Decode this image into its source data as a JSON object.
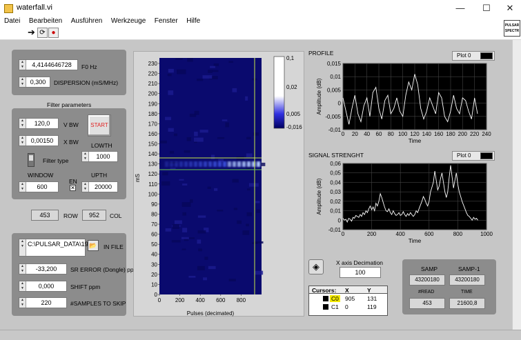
{
  "window": {
    "title": "waterfall.vi",
    "minimize": "—",
    "maximize": "☐",
    "close": "✕"
  },
  "menu": [
    "Datei",
    "Bearbeiten",
    "Ausführen",
    "Werkzeuge",
    "Fenster",
    "Hilfe"
  ],
  "vi_icon_text": [
    "PULSAR",
    "SPECTR"
  ],
  "controls": {
    "f0": {
      "value": "4,4144646728",
      "label": "F0 Hz"
    },
    "dispersion": {
      "value": "0,300",
      "label": "DISPERSION (mS/MHz)"
    },
    "filter_title": "Filter parameters",
    "vbw": {
      "value": "120,0",
      "label": "V BW"
    },
    "xbw": {
      "value": "0,00150",
      "label": "X BW"
    },
    "start_label": "START",
    "lowth": {
      "label": "LOWTH",
      "value": "1000"
    },
    "filter_type_label": "Filter type",
    "window": {
      "label": "WINDOW",
      "value": "600"
    },
    "en_label": "EN",
    "upth": {
      "label": "UPTH",
      "value": "20000"
    },
    "row": {
      "value": "453",
      "label": "ROW"
    },
    "col": {
      "value": "952",
      "label": "COL"
    },
    "in_file": {
      "value": "C:\\PULSAR_DATA\\1929+",
      "label": "IN FILE"
    },
    "sr_error": {
      "value": "-33,200",
      "label": "SR ERROR (Dongle) ppm"
    },
    "shift": {
      "value": "0,000",
      "label": "SHIFT ppm"
    },
    "samples_skip": {
      "value": "220",
      "label": "#SAMPLES TO SKIP"
    }
  },
  "waterfall": {
    "ylabel": "mS",
    "xlabel": "Pulses (decimated)",
    "y_ticks": [
      "230",
      "220",
      "210",
      "200",
      "190",
      "180",
      "170",
      "160",
      "150",
      "140",
      "130",
      "120",
      "110",
      "100",
      "90",
      "80",
      "70",
      "60",
      "50",
      "40",
      "30",
      "20",
      "10",
      "0"
    ],
    "x_ticks": [
      "0",
      "200",
      "400",
      "600",
      "800"
    ],
    "colorbar_ticks": [
      "0,1",
      "0,02",
      "0,005",
      "-0,016"
    ],
    "cursor_colors": [
      "#c8e84a",
      "#6ac850"
    ]
  },
  "decimation": {
    "label": "X axis Decimation",
    "value": "100"
  },
  "cursors": {
    "headers": [
      "Cursors:",
      "X",
      "Y"
    ],
    "rows": [
      {
        "name": "C0",
        "x": "905",
        "y": "131"
      },
      {
        "name": "C1",
        "x": "0",
        "y": "119"
      }
    ]
  },
  "samp_box": {
    "samp_label": "SAMP",
    "samp_value": "43200180",
    "samp1_label": "SAMP-1",
    "samp1_value": "43200180",
    "read_label": "#READ",
    "read_value": "453",
    "time_label": "TIME",
    "time_value": "21600,8"
  },
  "chart_data": [
    {
      "type": "line",
      "title": "PROFILE",
      "legend": "Plot 0",
      "xlabel": "Time",
      "ylabel": "Amplitude (dB)",
      "xlim": [
        0,
        240
      ],
      "ylim": [
        -0.01,
        0.015
      ],
      "x_ticks": [
        "0",
        "20",
        "40",
        "60",
        "80",
        "100",
        "120",
        "140",
        "160",
        "180",
        "200",
        "220",
        "240"
      ],
      "y_ticks": [
        "0,015",
        "0,01",
        "0,005",
        "0",
        "-0,005",
        "-0,01"
      ],
      "grid": true,
      "series": [
        {
          "name": "Plot 0",
          "x_step": 5,
          "values": [
            0.002,
            -0.003,
            -0.008,
            -0.002,
            0.003,
            -0.004,
            -0.007,
            -0.001,
            0.002,
            -0.005,
            0.004,
            0.006,
            -0.002,
            -0.006,
            0.001,
            0.003,
            -0.004,
            -0.002,
            0.002,
            -0.003,
            -0.005,
            0.003,
            0.008,
            0.005,
            0.011,
            0.007,
            -0.002,
            -0.006,
            -0.003,
            0.002,
            -0.001,
            -0.004,
            0.004,
            0.002,
            -0.005,
            -0.007,
            -0.003,
            0.003,
            -0.002,
            -0.004,
            0.002,
            0.001,
            -0.003,
            -0.006,
            0.002,
            -0.004
          ]
        }
      ]
    },
    {
      "type": "line",
      "title": "SIGNAL STRENGHT",
      "legend": "Plot 0",
      "xlabel": "Time",
      "ylabel": "Amplitude (dB)",
      "xlim": [
        0,
        1000
      ],
      "ylim": [
        -0.01,
        0.06
      ],
      "x_ticks": [
        "0",
        "200",
        "400",
        "600",
        "800",
        "1000"
      ],
      "y_ticks": [
        "0,06",
        "0,05",
        "0,04",
        "0,03",
        "0,02",
        "0,01",
        "0",
        "-0,01"
      ],
      "grid": true,
      "series": [
        {
          "name": "Plot 0",
          "x_step": 10,
          "values": [
            0.002,
            0.0,
            0.001,
            -0.002,
            0.002,
            0.001,
            -0.001,
            0.003,
            0.002,
            0.005,
            0.004,
            0.003,
            0.006,
            0.004,
            0.008,
            0.006,
            0.01,
            0.008,
            0.012,
            0.015,
            0.011,
            0.014,
            0.01,
            0.018,
            0.015,
            0.02,
            0.028,
            0.024,
            0.019,
            0.014,
            0.01,
            0.009,
            0.012,
            0.008,
            0.006,
            0.01,
            0.007,
            0.005,
            0.006,
            0.008,
            0.005,
            0.006,
            0.009,
            0.006,
            0.004,
            0.007,
            0.005,
            0.008,
            0.006,
            0.004,
            0.006,
            0.01,
            0.008,
            0.012,
            0.016,
            0.02,
            0.025,
            0.022,
            0.018,
            0.015,
            0.02,
            0.03,
            0.035,
            0.04,
            0.052,
            0.042,
            0.032,
            0.036,
            0.044,
            0.05,
            0.04,
            0.03,
            0.024,
            0.03,
            0.045,
            0.058,
            0.046,
            0.034,
            0.042,
            0.05,
            0.038,
            0.03,
            0.025,
            0.02,
            0.016,
            0.012,
            0.008,
            0.005,
            0.004,
            0.002,
            0.0,
            0.003,
            0.001,
            0.002,
            0.0
          ]
        }
      ]
    }
  ]
}
